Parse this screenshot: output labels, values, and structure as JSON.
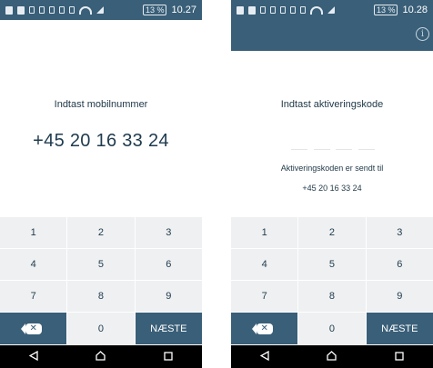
{
  "status": {
    "battery": "13 %",
    "left_time": "10.27",
    "right_time": "10.28"
  },
  "left_screen": {
    "prompt": "Indtast mobilnummer",
    "phone_number": "+45 20 16 33 24"
  },
  "right_screen": {
    "prompt": "Indtast aktiveringskode",
    "sent_label": "Aktiveringskoden er sendt til",
    "sent_number": "+45 20 16 33 24"
  },
  "keypad": {
    "keys": [
      "1",
      "2",
      "3",
      "4",
      "5",
      "6",
      "7",
      "8",
      "9"
    ],
    "zero": "0",
    "next": "NÆSTE",
    "backspace_icon": "backspace-icon"
  },
  "colors": {
    "primary": "#3a5f78",
    "key_bg": "#eef0f1",
    "text": "#1f3a4d"
  }
}
